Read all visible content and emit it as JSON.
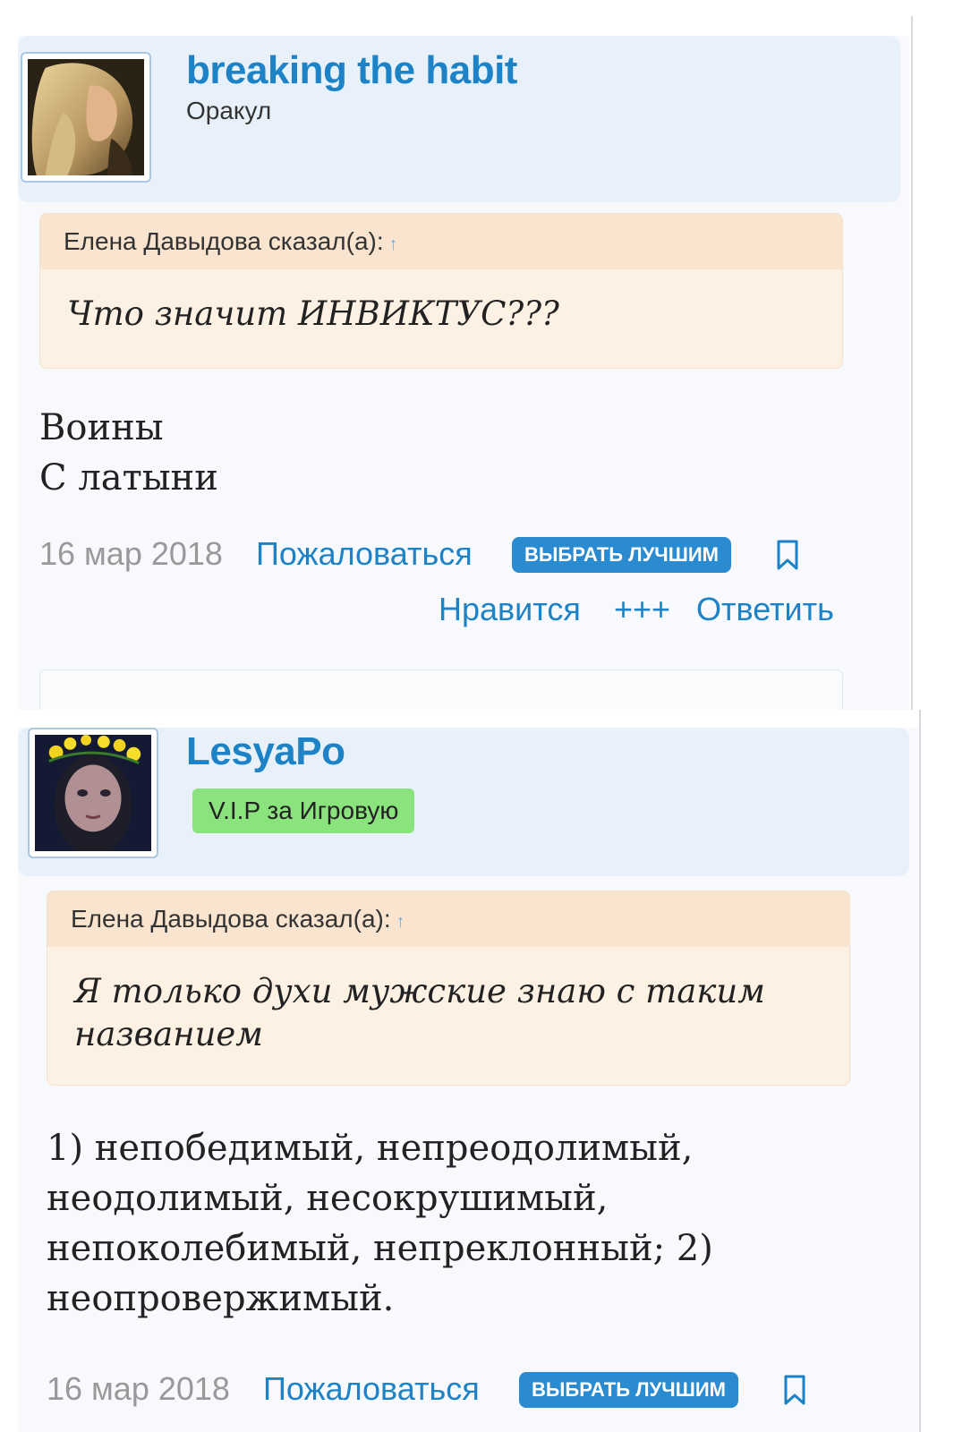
{
  "posts": [
    {
      "username": "breaking the habit",
      "rank": "Оракул",
      "quote_author": "Елена Давыдова сказал(а):",
      "quote_text": "Что значит ИНВИКТУС???",
      "answer_lines": [
        "Воины",
        "С латыни"
      ],
      "date": "16 мар 2018",
      "complain": "Пожаловаться",
      "best": "ВЫБРАТЬ ЛУЧШИМ",
      "like": "Нравится",
      "plus": "+++",
      "reply": "Ответить"
    },
    {
      "username": "LesyaPo",
      "badge": "V.I.P за Игровую",
      "quote_author": "Елена Давыдова сказал(а):",
      "quote_text": "Я только духи мужские знаю с таким названием",
      "answer_lines": [
        "1) непобедимый, непреодолимый,",
        "неодолимый, несокрушимый,",
        "непоколебимый, непреклонный; 2)",
        "неопровержимый."
      ],
      "date": "16 мар 2018",
      "complain": "Пожаловаться",
      "best": "ВЫБРАТЬ ЛУЧШИМ"
    }
  ],
  "icons": {
    "quote_arrow": "up-arrow-icon",
    "bookmark": "bookmark-icon"
  },
  "colors": {
    "link": "#1e82c6",
    "header_bg": "#e8f1fa",
    "quote_bg": "#fdf1e4",
    "vip_badge": "#8be37d",
    "best_button": "#2a8bd0"
  }
}
